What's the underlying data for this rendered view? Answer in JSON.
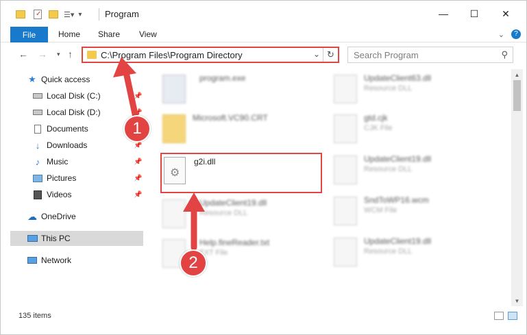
{
  "window": {
    "title": "Program",
    "controls": {
      "minimize": "—",
      "maximize": "☐",
      "close": "✕"
    }
  },
  "ribbon": {
    "tabs": [
      "File",
      "Home",
      "Share",
      "View"
    ]
  },
  "address": {
    "path": "C:\\Program Files\\Program Directory",
    "search_placeholder": "Search Program"
  },
  "sidebar": {
    "items": [
      {
        "label": "Quick access",
        "icon": "star-icon",
        "pinned": false
      },
      {
        "label": "Local Disk (C:)",
        "icon": "drive-icon",
        "pinned": true
      },
      {
        "label": "Local Disk (D:)",
        "icon": "drive-icon",
        "pinned": true
      },
      {
        "label": "Documents",
        "icon": "documents-icon",
        "pinned": true
      },
      {
        "label": "Downloads",
        "icon": "download-icon",
        "pinned": true
      },
      {
        "label": "Music",
        "icon": "music-icon",
        "pinned": true
      },
      {
        "label": "Pictures",
        "icon": "pictures-icon",
        "pinned": true
      },
      {
        "label": "Videos",
        "icon": "videos-icon",
        "pinned": true
      },
      {
        "label": "OneDrive",
        "icon": "cloud-icon",
        "pinned": false
      },
      {
        "label": "This PC",
        "icon": "computer-icon",
        "pinned": false,
        "selected": true
      },
      {
        "label": "Network",
        "icon": "network-icon",
        "pinned": false
      }
    ]
  },
  "files": [
    {
      "name": "program.exe",
      "type": ""
    },
    {
      "name": "UpdateClient63.dll",
      "type": "Resource DLL"
    },
    {
      "name": "Microsoft.VC90.CRT",
      "type": ""
    },
    {
      "name": "gtd.cjk",
      "type": "CJK File"
    },
    {
      "name": "g2i.dll",
      "type": ""
    },
    {
      "name": "UpdateClient19.dll",
      "type": "Resource DLL"
    },
    {
      "name": "UpdateClient19.dll",
      "type": "Resource DLL"
    },
    {
      "name": "SndToWP16.wcm",
      "type": "WCM File"
    },
    {
      "name": "Help.fineReader.txt",
      "type": "TXT File"
    },
    {
      "name": "UpdateClient19.dll",
      "type": "Resource DLL"
    }
  ],
  "status": {
    "items": "135 items"
  },
  "annotations": {
    "one": "1",
    "two": "2"
  },
  "colors": {
    "accent": "#1979ca",
    "highlight": "#e24444",
    "folder": "#f3c94e"
  }
}
